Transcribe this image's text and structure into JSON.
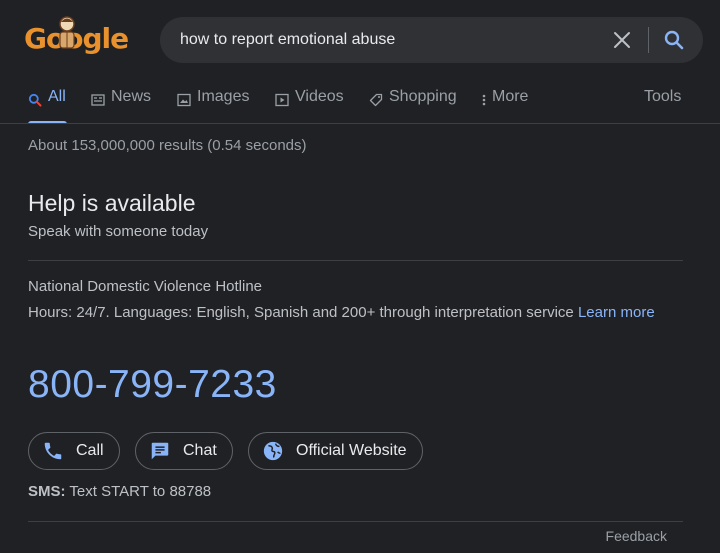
{
  "logo": {
    "text": "Google"
  },
  "search": {
    "query": "how to report emotional abuse"
  },
  "tabs": [
    {
      "label": "All",
      "icon": "search-icon"
    },
    {
      "label": "News",
      "icon": "news-icon"
    },
    {
      "label": "Images",
      "icon": "images-icon"
    },
    {
      "label": "Videos",
      "icon": "videos-icon"
    },
    {
      "label": "Shopping",
      "icon": "shopping-tag-icon"
    },
    {
      "label": "More",
      "icon": "more-vert-icon"
    }
  ],
  "tools_label": "Tools",
  "result_stats": "About 153,000,000 results (0.54 seconds)",
  "help": {
    "title": "Help is available",
    "subtitle": "Speak with someone today",
    "org_name": "National Domestic Violence Hotline",
    "hours_text": "Hours: 24/7. Languages: English, Spanish and 200+ through interpretation service",
    "learn_more": "Learn more",
    "phone": "800-799-7233",
    "actions": [
      {
        "label": "Call",
        "icon": "phone-icon"
      },
      {
        "label": "Chat",
        "icon": "chat-icon"
      },
      {
        "label": "Official Website",
        "icon": "globe-icon"
      }
    ],
    "sms_label": "SMS:",
    "sms_text": "Text START to 88788"
  },
  "feedback_label": "Feedback",
  "colors": {
    "background": "#202124",
    "accent_blue": "#8ab4f8",
    "text_primary": "#e8eaed",
    "text_secondary": "#bdc1c6"
  }
}
